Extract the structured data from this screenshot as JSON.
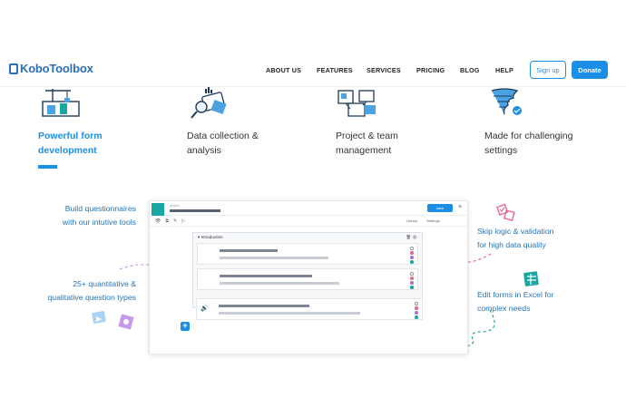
{
  "brand": {
    "logo_text": "KoboToolbox"
  },
  "nav": {
    "items": [
      "ABOUT US",
      "FEATURES",
      "SERVICES",
      "PRICING",
      "BLOG",
      "HELP"
    ],
    "signup_label": "Sign up",
    "donate_label": "Donate"
  },
  "features": [
    {
      "label_line1": "Powerful form",
      "label_line2": "development",
      "active": true,
      "icon": "form-builder-icon"
    },
    {
      "label_line1": "Data collection &",
      "label_line2": "analysis",
      "active": false,
      "icon": "data-analysis-icon"
    },
    {
      "label_line1": "Project & team",
      "label_line2": "management",
      "active": false,
      "icon": "team-management-icon"
    },
    {
      "label_line1": "Made for challenging",
      "label_line2": "settings",
      "active": false,
      "icon": "tornado-icon"
    }
  ],
  "callouts": {
    "build": {
      "line1": "Build questionnaires",
      "line2": "with our intutive tools"
    },
    "types": {
      "line1": "25+ quantitative &",
      "line2": "qualitative question types"
    },
    "skip": {
      "line1": "Skip logic & validation",
      "line2": "for high data quality"
    },
    "excel": {
      "line1": "Edit forms in Excel for",
      "line2": "complex needs"
    }
  },
  "mock_ui": {
    "project_label": "project",
    "save_label": "save",
    "close_glyph": "×",
    "toolbar_glyphs": [
      "👁",
      "⧉",
      "✎",
      "▷"
    ],
    "library_label": "Library",
    "settings_label": "Settings",
    "group_title": "Introduction",
    "group_toggle": "▾",
    "group_icons": "🗑 ⚙",
    "sound_glyph": "🔊",
    "plus_glyph": "+"
  },
  "colors": {
    "accent": "#1f8fe0",
    "teal": "#1aa6a1",
    "pink": "#e86a8e",
    "purple": "#a774d9",
    "text_blue": "#2675b8"
  }
}
